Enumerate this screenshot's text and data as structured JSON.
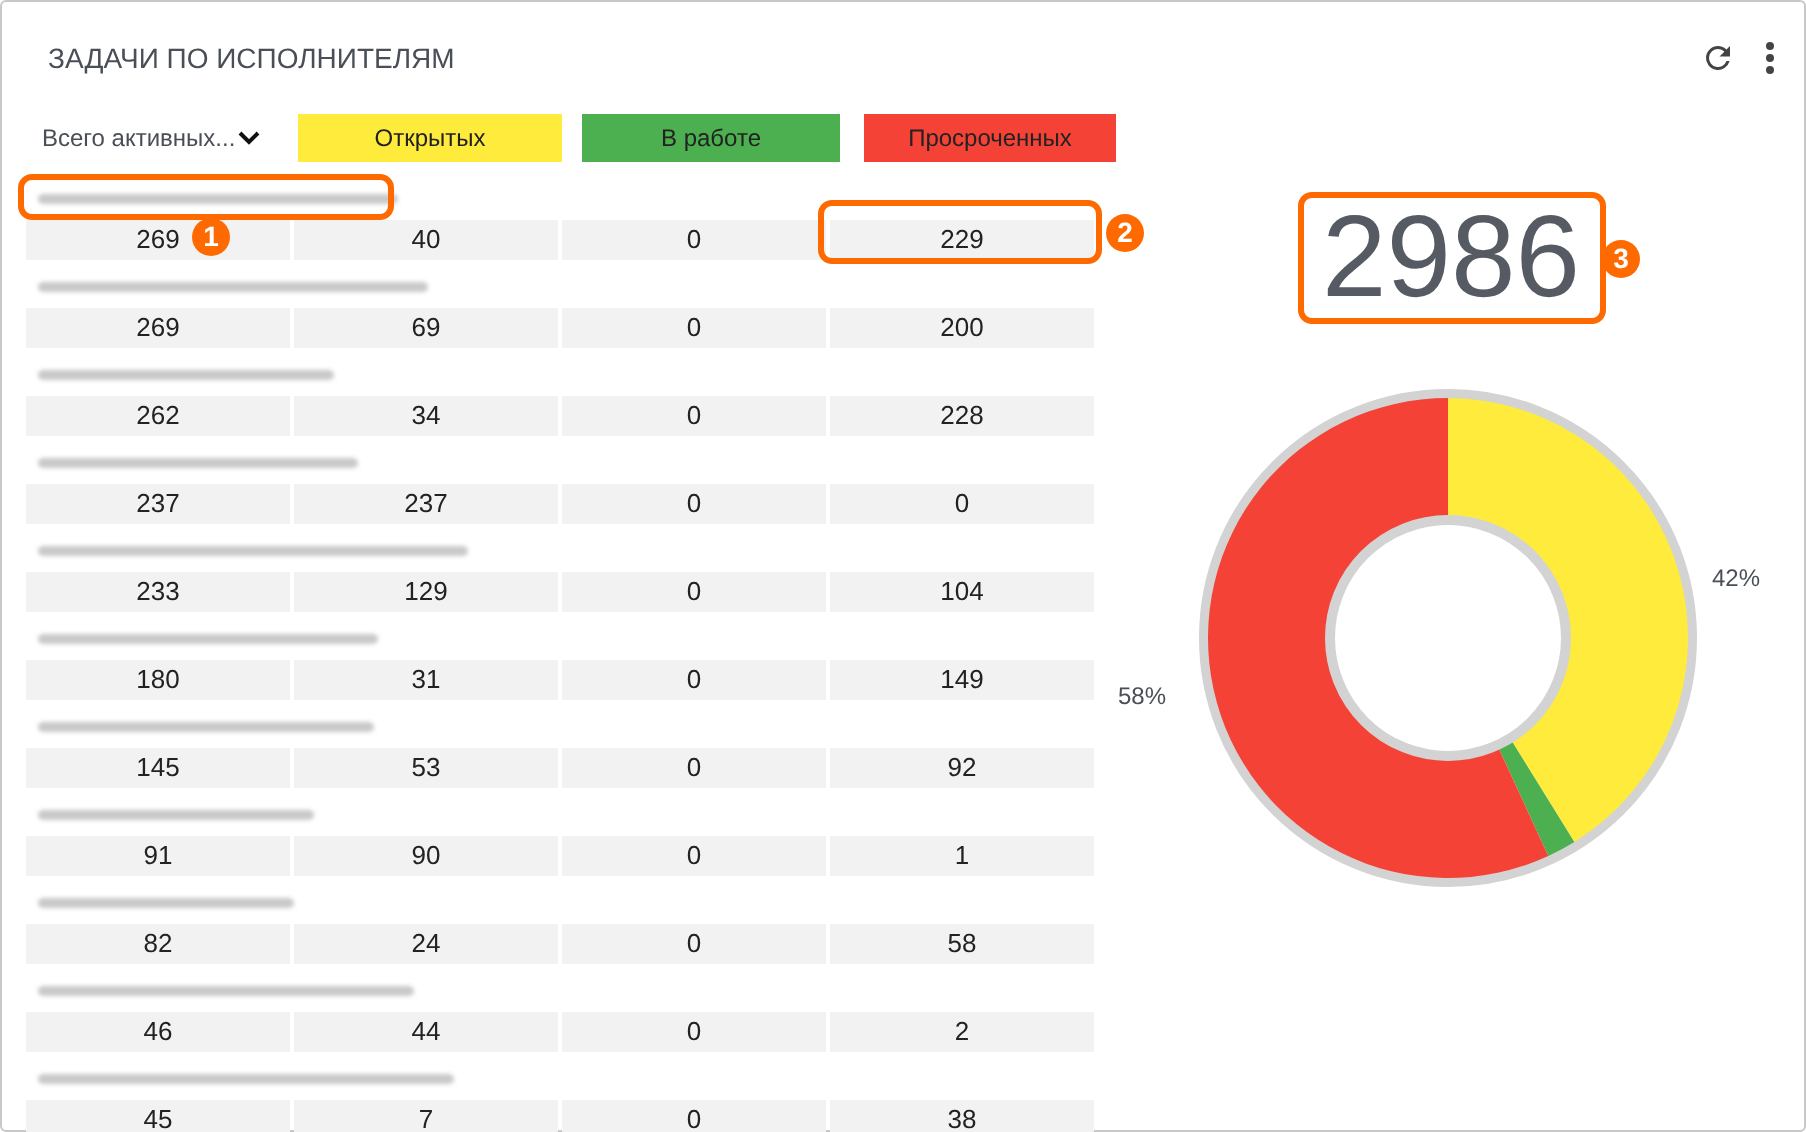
{
  "card": {
    "title": "ЗАДАЧИ ПО ИСПОЛНИТЕЛЯМ"
  },
  "filter": {
    "label": "Всего активных..."
  },
  "columns": [
    {
      "label": "Открытых",
      "color": "#ffeb3b"
    },
    {
      "label": "В работе",
      "color": "#4caf50"
    },
    {
      "label": "Просроченных",
      "color": "#f44336"
    }
  ],
  "rows": [
    {
      "cells": [
        "269",
        "40",
        "0",
        "229"
      ]
    },
    {
      "cells": [
        "269",
        "69",
        "0",
        "200"
      ]
    },
    {
      "cells": [
        "262",
        "34",
        "0",
        "228"
      ]
    },
    {
      "cells": [
        "237",
        "237",
        "0",
        "0"
      ]
    },
    {
      "cells": [
        "233",
        "129",
        "0",
        "104"
      ]
    },
    {
      "cells": [
        "180",
        "31",
        "0",
        "149"
      ]
    },
    {
      "cells": [
        "145",
        "53",
        "0",
        "92"
      ]
    },
    {
      "cells": [
        "91",
        "90",
        "0",
        "1"
      ]
    },
    {
      "cells": [
        "82",
        "24",
        "0",
        "58"
      ]
    },
    {
      "cells": [
        "46",
        "44",
        "0",
        "2"
      ]
    },
    {
      "cells": [
        "45",
        "7",
        "0",
        "38"
      ]
    }
  ],
  "total": "2986",
  "callouts": [
    "1",
    "2",
    "3"
  ],
  "chart_data": {
    "type": "donut",
    "values": [
      42,
      2,
      58
    ],
    "colors": [
      "#ffeb3b",
      "#4caf50",
      "#f44336"
    ],
    "data_labels": true,
    "value_labels": [
      "42%",
      null,
      "58%"
    ]
  }
}
